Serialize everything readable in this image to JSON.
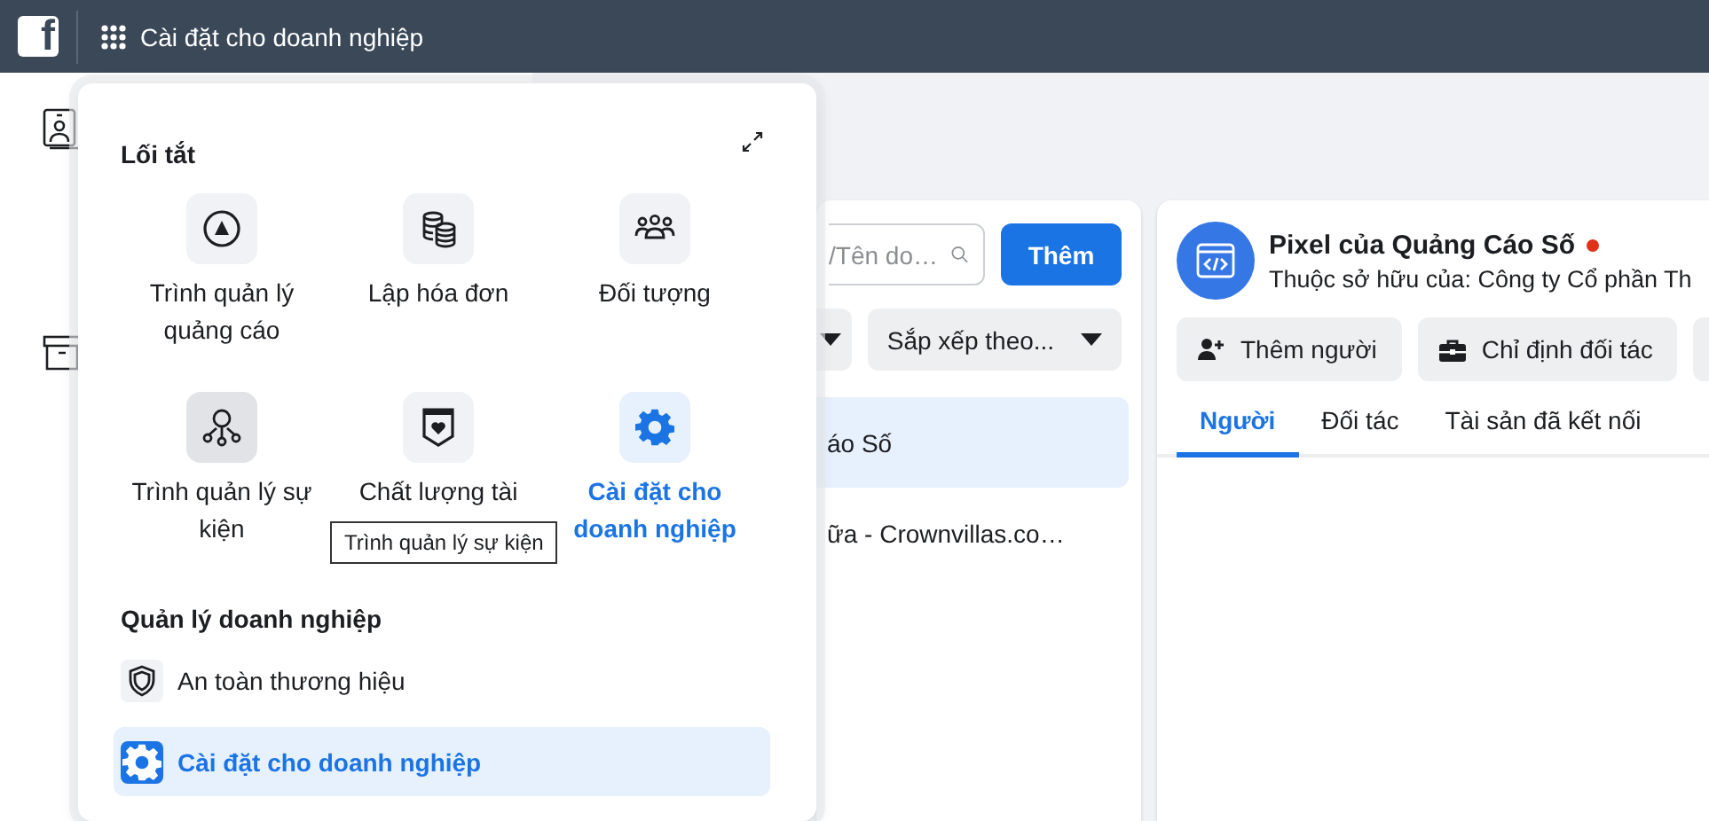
{
  "top_bar": {
    "logo": "f",
    "title": "Cài đặt cho doanh nghiệp"
  },
  "menu": {
    "shortcuts_heading": "Lối tắt",
    "shortcuts": [
      {
        "label": "Trình quản lý quảng cáo",
        "kind": "ads",
        "selected": false,
        "hovered": false
      },
      {
        "label": "Lập hóa đơn",
        "kind": "billing",
        "selected": false,
        "hovered": false
      },
      {
        "label": "Đối tượng",
        "kind": "audience",
        "selected": false,
        "hovered": false
      },
      {
        "label": "Trình quản lý sự kiện",
        "kind": "events",
        "selected": false,
        "hovered": true
      },
      {
        "label": "Chất lượng tài",
        "kind": "quality",
        "selected": false,
        "hovered": false
      },
      {
        "label": "Cài đặt cho doanh nghiệp",
        "kind": "gear",
        "selected": true,
        "hovered": false
      }
    ],
    "tooltip": "Trình quản lý sự kiện",
    "section_heading": "Quản lý doanh nghiệp",
    "items": [
      {
        "label": "An toàn thương hiệu",
        "kind": "shield",
        "selected": false
      },
      {
        "label": "Cài đặt cho doanh nghiệp",
        "kind": "gear",
        "selected": true
      }
    ]
  },
  "asset_list": {
    "search": {
      "placeholder": "/Tên do…"
    },
    "add_button": "Thêm",
    "sort": "Sắp xếp theo...",
    "items": [
      {
        "label": "áo Số",
        "selected": true
      },
      {
        "label": "ữa - Crownvillas.co…",
        "selected": false
      }
    ]
  },
  "detail": {
    "title": "Pixel của Quảng Cáo Số",
    "warning": true,
    "owner": "Thuộc sở hữu của: Công ty Cổ phần Th",
    "actions": [
      {
        "label": "Thêm người",
        "kind": "person-add"
      },
      {
        "label": "Chỉ định đối tác",
        "kind": "briefcase"
      }
    ],
    "tabs": [
      {
        "label": "Người",
        "selected": true
      },
      {
        "label": "Đối tác",
        "selected": false
      },
      {
        "label": "Tài sản đã kết nối",
        "selected": false
      }
    ]
  }
}
